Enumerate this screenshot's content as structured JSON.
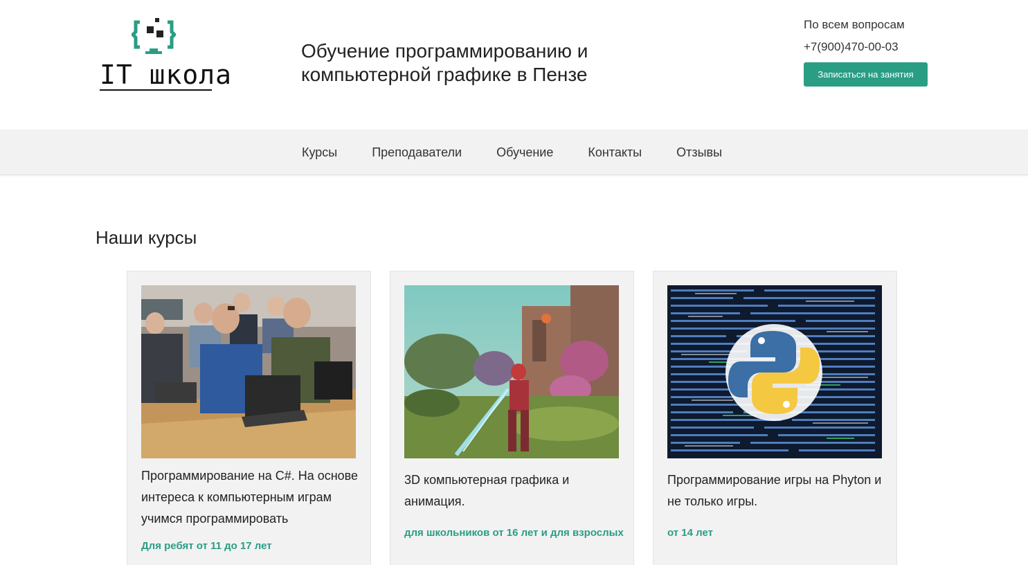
{
  "header": {
    "logo_text": "IT школа",
    "tagline": "Обучение программированию и компьютерной графике в Пензе",
    "contact_question": "По всем вопросам",
    "phone": "+7(900)470-00-03",
    "cta_label": "Записаться на занятия"
  },
  "nav": {
    "items": [
      {
        "label": "Курсы"
      },
      {
        "label": "Преподаватели"
      },
      {
        "label": "Обучение"
      },
      {
        "label": "Контакты"
      },
      {
        "label": "Отзывы"
      }
    ]
  },
  "courses": {
    "section_title": "Наши курсы",
    "cards": [
      {
        "title": "Программирование на C#. На основе интереса к компьютерным играм учимся программировать",
        "age": "Для ребят от 11 до 17 лет",
        "image": "classroom-photo"
      },
      {
        "title": "3D компьютерная графика и анимация.",
        "age": "для школьников от 16 лет и для взрослых",
        "image": "3d-game-scene"
      },
      {
        "title": "Программирование игры на Phyton и не только игры.",
        "age": "от 14 лет",
        "image": "python-code-logo"
      }
    ]
  },
  "colors": {
    "accent": "#2a9d85",
    "nav_bg": "#f2f2f2",
    "card_bg": "#f2f2f2"
  }
}
